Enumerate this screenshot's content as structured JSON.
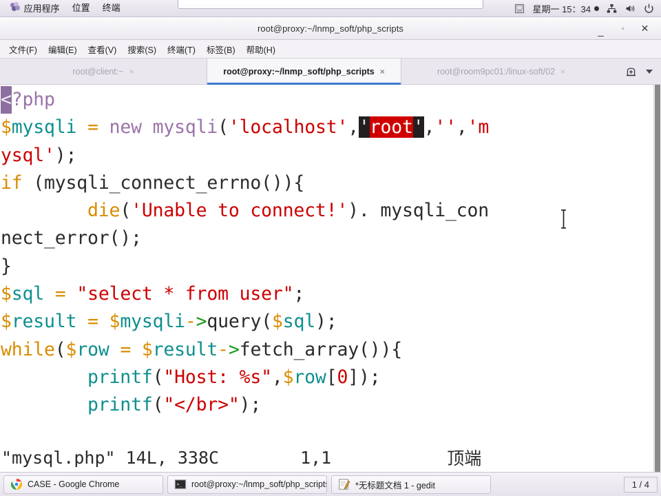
{
  "top_panel": {
    "apps_label": "应用程序",
    "places_label": "位置",
    "terminal_label": "终端",
    "clock": "星期一  15：34",
    "icons": [
      "keyboard-icon",
      "network-icon",
      "volume-icon",
      "power-icon"
    ]
  },
  "window": {
    "title": "root@proxy:~/lnmp_soft/php_scripts",
    "minimize": "_",
    "maximize": "▫",
    "close": "✕"
  },
  "menubar": {
    "items": [
      {
        "label": "文件(F)",
        "name": "menu-file"
      },
      {
        "label": "编辑(E)",
        "name": "menu-edit"
      },
      {
        "label": "查看(V)",
        "name": "menu-view"
      },
      {
        "label": "搜索(S)",
        "name": "menu-search"
      },
      {
        "label": "终端(T)",
        "name": "menu-terminal"
      },
      {
        "label": "标签(B)",
        "name": "menu-tabs"
      },
      {
        "label": "帮助(H)",
        "name": "menu-help"
      }
    ]
  },
  "tabs": [
    {
      "label": "root@client:~",
      "active": false,
      "close": "×"
    },
    {
      "label": "root@proxy:~/lnmp_soft/php_scripts",
      "active": true,
      "close": "×"
    },
    {
      "label": "root@room9pc01:/linux-soft/02",
      "active": false,
      "close": "×"
    }
  ],
  "tab_tools": {
    "new_tab": "new-tab-icon",
    "dropdown": "chevron-down-icon"
  },
  "terminal": {
    "file_name": "mysql.php",
    "lines": [
      "<?php",
      "$mysqli = new mysqli('localhost','root','','mysql');",
      "if (mysqli_connect_errno()){",
      "        die('Unable to connect!'). mysqli_connect_error();",
      "}",
      "$sql = \"select * from user\";",
      "$result = $mysqli->query($sql);",
      "while($row = $result->fetch_array()){",
      "        printf(\"Host: %s\",$row[0]);",
      "        printf(\"</br>\");"
    ],
    "selection_text": "root",
    "cursor_char": "<"
  },
  "status_line": {
    "file": "\"mysql.php\" 14L, 338C",
    "position": "1,1",
    "location": "顶端"
  },
  "taskbar": {
    "items": [
      {
        "label": "CASE - Google Chrome",
        "icon": "chrome-icon",
        "name": "taskbar-chrome"
      },
      {
        "label": "root@proxy:~/lnmp_soft/php_scripts",
        "icon": "terminal-icon",
        "name": "taskbar-terminal"
      },
      {
        "label": "*无标题文档 1 - gedit",
        "icon": "gedit-icon",
        "name": "taskbar-gedit"
      }
    ],
    "workspace": "1 / 4"
  },
  "colors": {
    "accent": "#3b7bd4",
    "string": "#cc0000",
    "variable": "#0e8f8f",
    "keyword": "#d98c00",
    "selection_bg": "#cf0000",
    "cursor_bg": "#8d6fa0"
  }
}
